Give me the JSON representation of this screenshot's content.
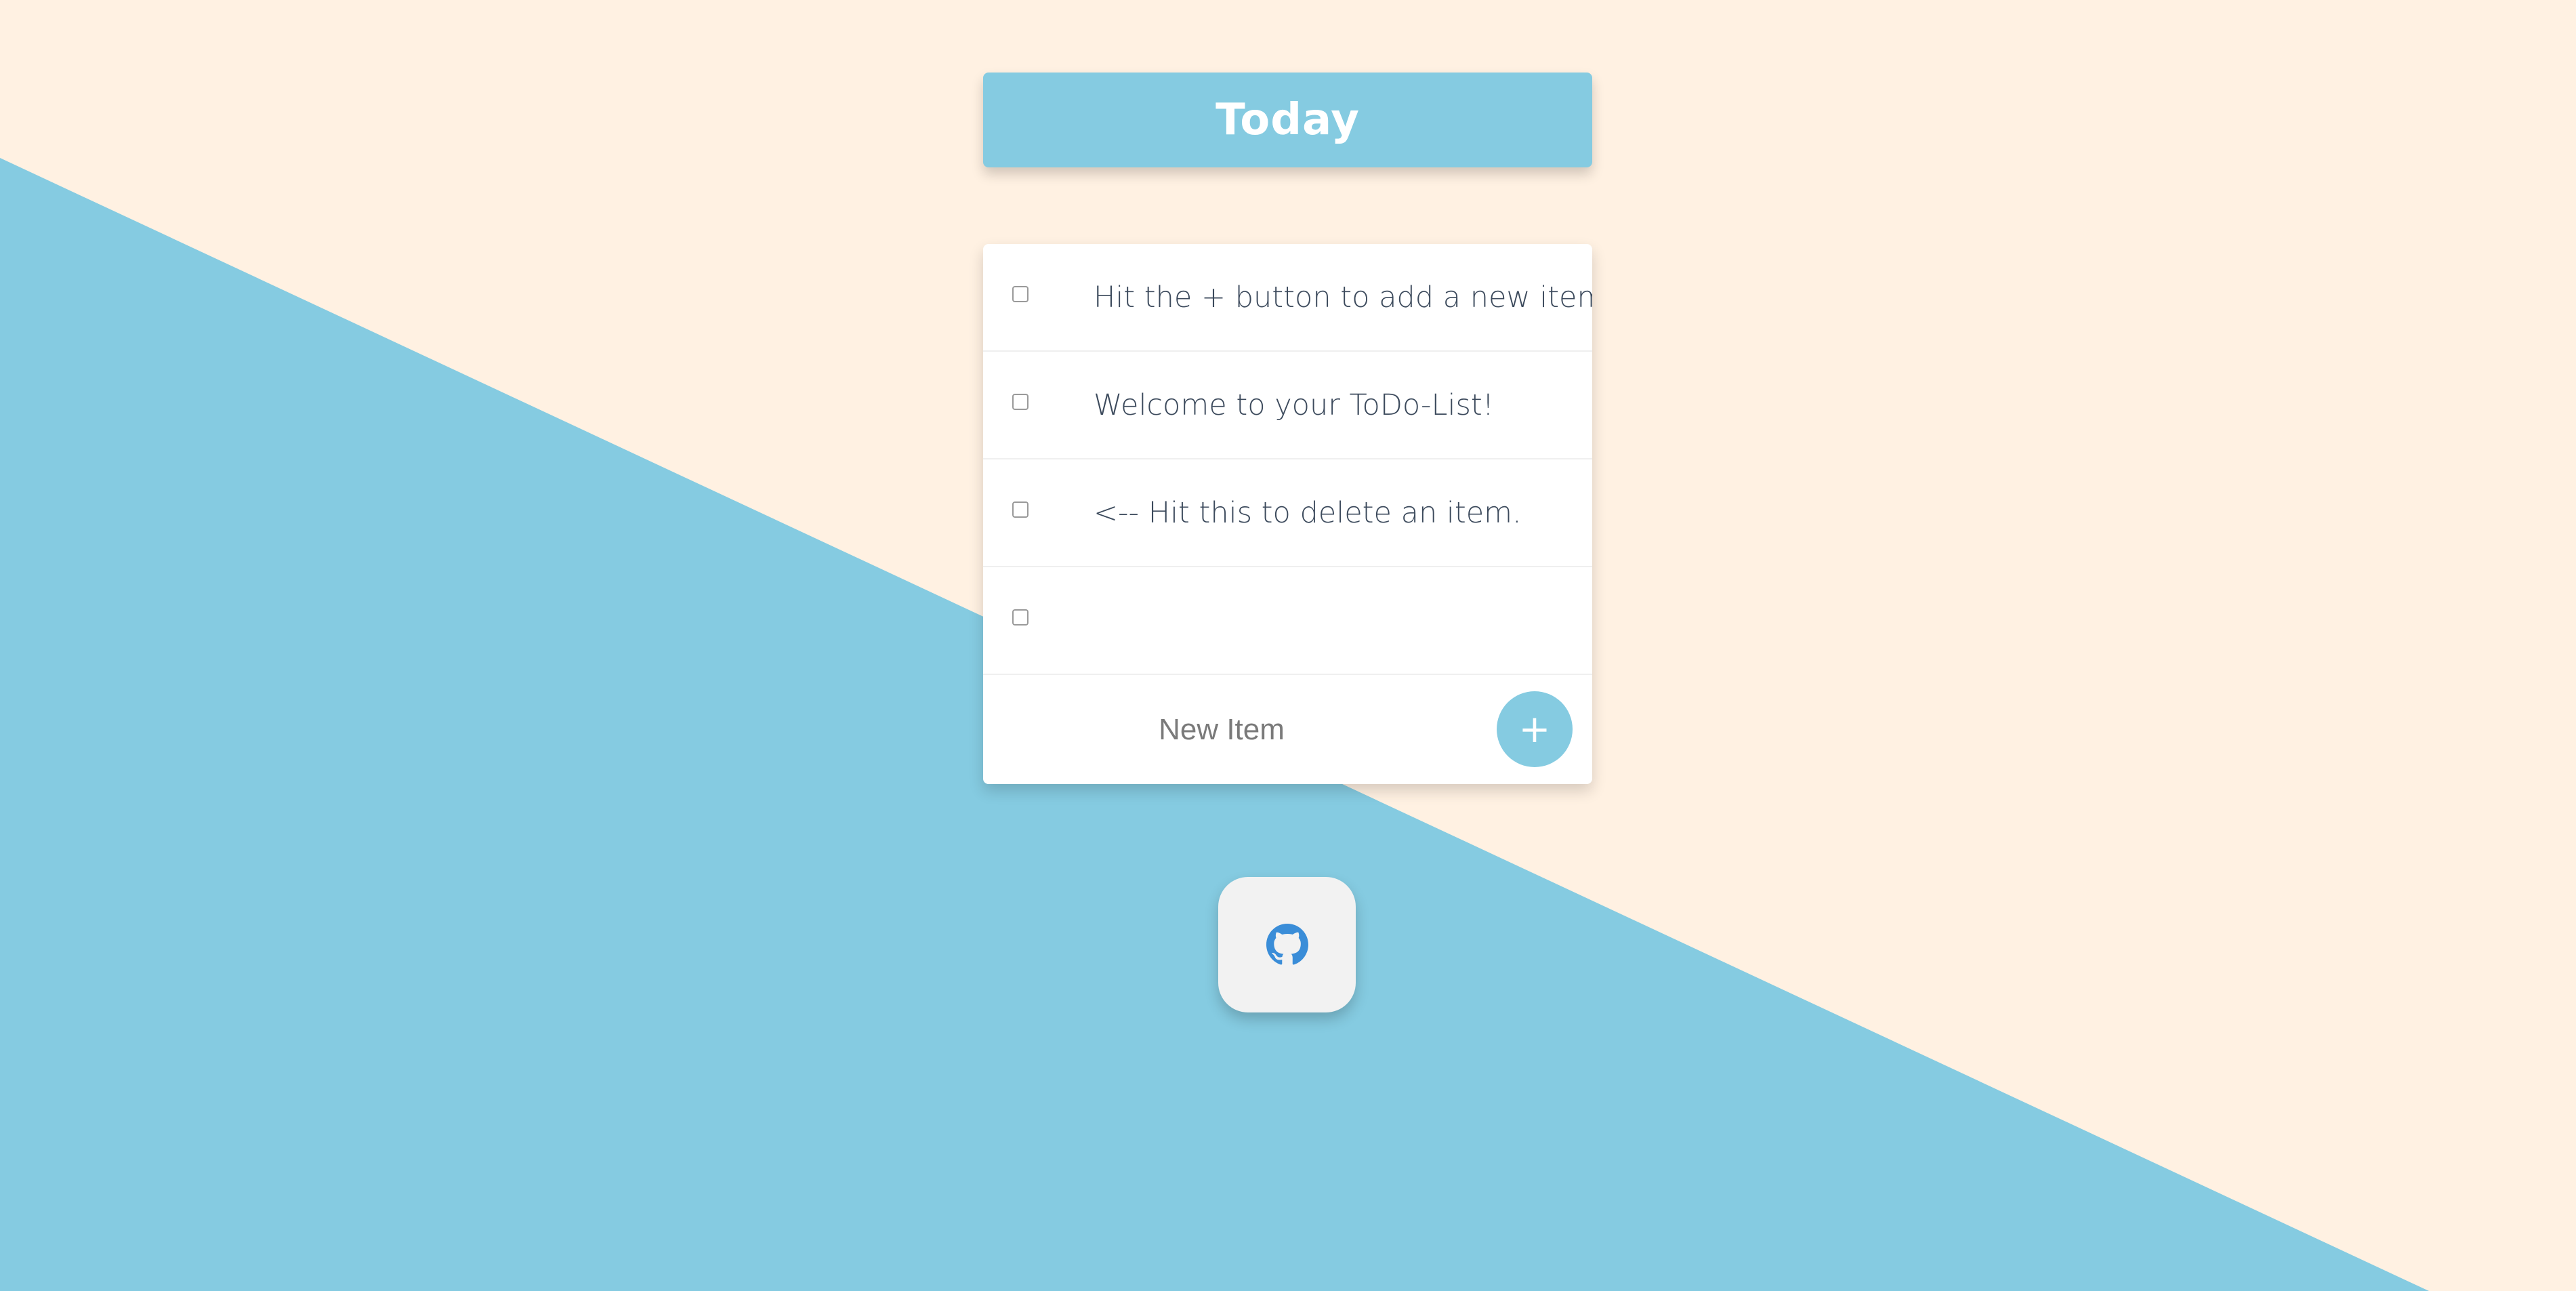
{
  "header": {
    "title": "Today"
  },
  "todo_list": {
    "items": [
      {
        "text": "Hit the + button to add a new item.",
        "checked": false
      },
      {
        "text": "Welcome to your ToDo-List!",
        "checked": false
      },
      {
        "text": "<-- Hit this to delete an item.",
        "checked": false
      },
      {
        "text": "",
        "checked": false
      }
    ],
    "new_item": {
      "placeholder": "New Item",
      "value": "",
      "add_label": "+"
    }
  },
  "footer": {
    "github_icon": "github-icon"
  },
  "colors": {
    "background_light": "#FFF1E2",
    "accent_blue": "#85CBE1",
    "text_dark": "#3C4A5C",
    "github_blue": "#3A8DD8"
  }
}
